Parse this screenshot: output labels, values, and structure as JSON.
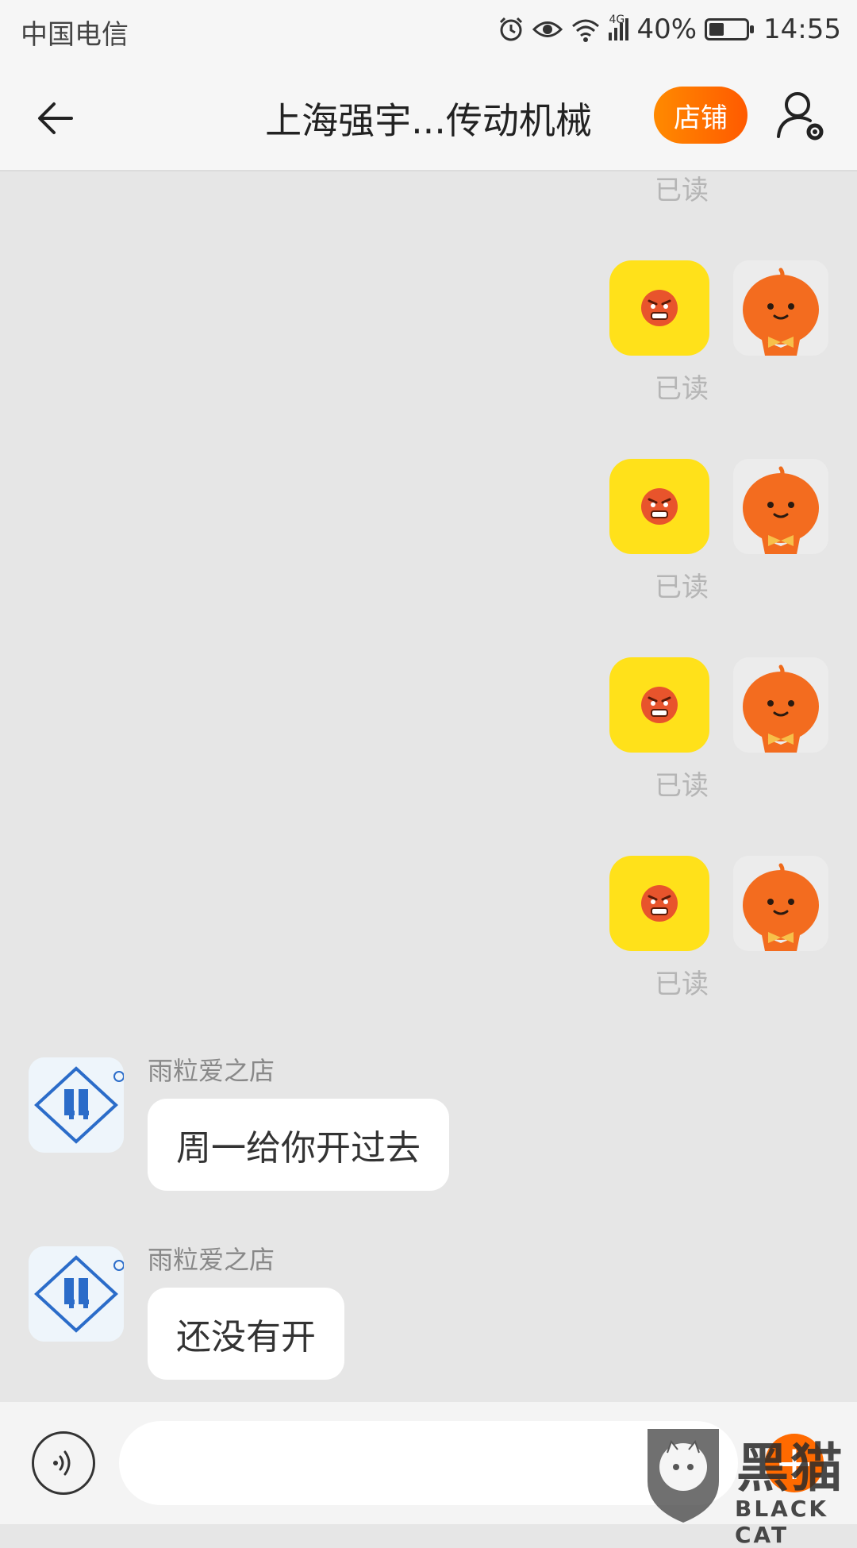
{
  "status_bar": {
    "carrier": "中国电信",
    "network": "4G",
    "battery": "40%",
    "battery_level": 0.4,
    "time": "14:55"
  },
  "header": {
    "title": "上海强宇...传动机械",
    "shop_label": "店铺"
  },
  "colors": {
    "accent": "#ff6a00",
    "sticker_bg": "#ffe11a",
    "chat_bg": "#e6e6e6"
  },
  "chat": {
    "top_read_label": "已读",
    "sent_stickers": [
      {
        "sticker": "angry-face-sticker",
        "read_label": "已读"
      },
      {
        "sticker": "angry-face-sticker",
        "read_label": "已读"
      },
      {
        "sticker": "angry-face-sticker",
        "read_label": "已读"
      },
      {
        "sticker": "angry-face-sticker",
        "read_label": "已读"
      }
    ],
    "received": [
      {
        "sender": "雨粒爱之店",
        "text": "周一给你开过去"
      },
      {
        "sender": "雨粒爱之店",
        "text": "还没有开"
      }
    ]
  },
  "input_bar": {
    "placeholder": "",
    "plus_label": "+"
  },
  "watermark": {
    "title": "黑猫",
    "subtitle": "BLACK CAT"
  }
}
